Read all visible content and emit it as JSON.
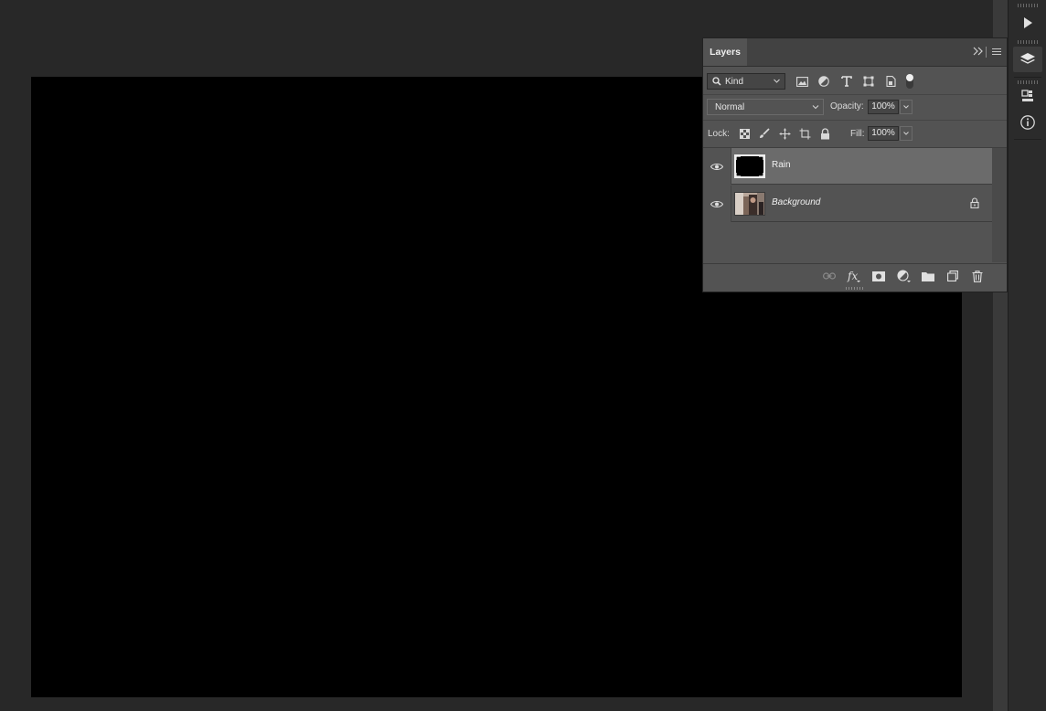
{
  "layers_panel": {
    "tab_label": "Layers",
    "filter": {
      "kind_label": "Kind"
    },
    "blend_mode": "Normal",
    "opacity_label": "Opacity:",
    "opacity_value": "100%",
    "lock_label": "Lock:",
    "fill_label": "Fill:",
    "fill_value": "100%",
    "layers": [
      {
        "name": "Rain",
        "visible": true,
        "selected": true,
        "locked": false
      },
      {
        "name": "Background",
        "visible": true,
        "selected": false,
        "locked": true
      }
    ]
  },
  "colors": {
    "workspace_bg": "#282828",
    "canvas": "#000000",
    "panel_bg": "#535353",
    "selected_row": "#6b6b6b"
  },
  "icons": {
    "filter_icons": [
      "image-filter-icon",
      "adjustment-filter-icon",
      "type-filter-icon",
      "shape-filter-icon",
      "smart-object-filter-icon"
    ],
    "lock_icons": [
      "lock-transparent-pixels-icon",
      "lock-image-pixels-icon",
      "lock-position-icon",
      "lock-artboard-icon",
      "lock-all-icon"
    ],
    "footer_icons": [
      "link-layers-icon",
      "fx-icon",
      "add-mask-icon",
      "new-adjustment-layer-icon",
      "new-group-icon",
      "new-layer-icon",
      "delete-layer-icon"
    ],
    "right_strip": [
      "play-icon",
      "layers-icon",
      "libraries-icon",
      "info-icon"
    ]
  }
}
